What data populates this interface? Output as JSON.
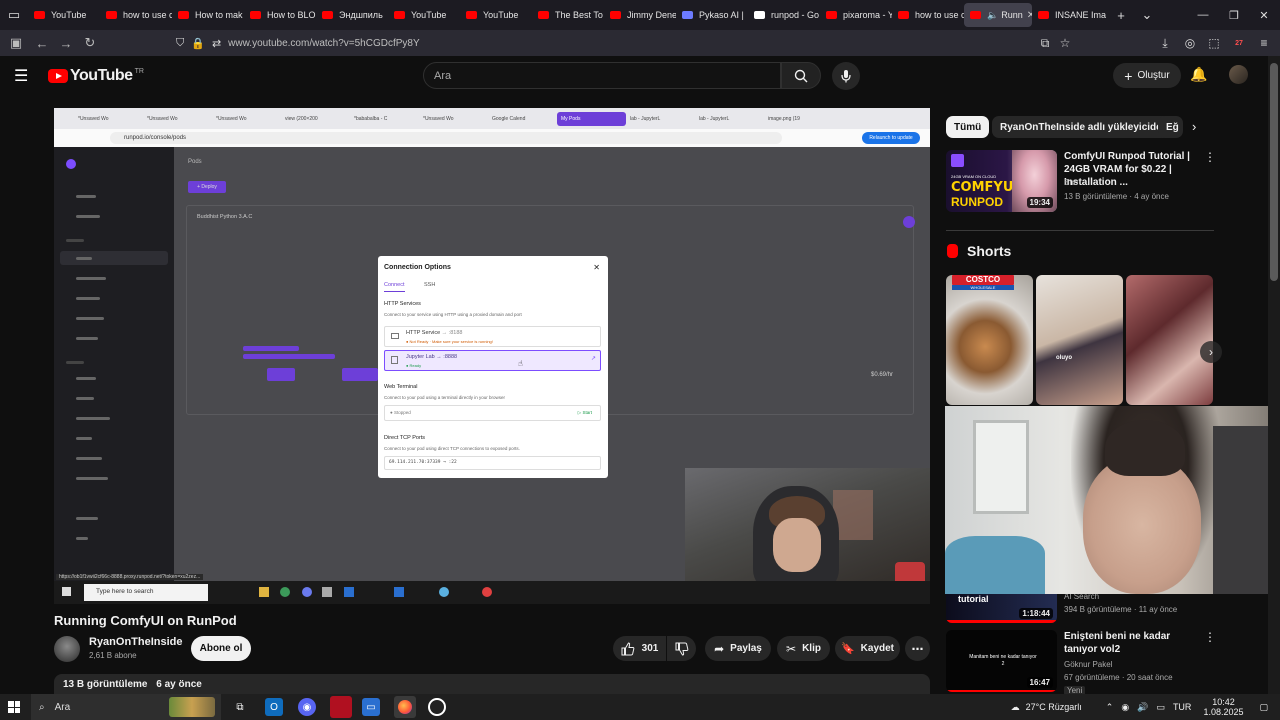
{
  "browser": {
    "tabs": [
      {
        "label": "YouTube",
        "color": "#ff0000"
      },
      {
        "label": "how to use c",
        "color": "#ff0000"
      },
      {
        "label": "How to mak",
        "color": "#ff0000"
      },
      {
        "label": "How to BLO",
        "color": "#ff0000"
      },
      {
        "label": "Эндшпиль",
        "color": "#ff0000"
      },
      {
        "label": "YouTube",
        "color": "#ff0000"
      },
      {
        "label": "YouTube",
        "color": "#ff0000"
      },
      {
        "label": "The Best To",
        "color": "#ff0000"
      },
      {
        "label": "Jimmy Dene",
        "color": "#ff0000"
      },
      {
        "label": "Pykaso AI |",
        "color": "#6c7bff"
      },
      {
        "label": "runpod - Go",
        "color": "#ffffff"
      },
      {
        "label": "pixaroma - Y",
        "color": "#ff0000"
      },
      {
        "label": "how to use c",
        "color": "#ff0000"
      }
    ],
    "active_tab": {
      "label": "Runn",
      "color": "#ff0000"
    },
    "last_tab": {
      "label": "INSANE Ima",
      "color": "#ff0000"
    },
    "url": "www.youtube.com/watch?v=5hCGDcfPy8Y",
    "notification_badge": "27"
  },
  "youtube": {
    "logo_text": "YouTube",
    "country_code": "TR",
    "search_placeholder": "Ara",
    "create_label": "Oluştur"
  },
  "video_frame": {
    "inner_tabs": [
      "*Unsaved Wo",
      "*Unsaved Wo",
      "*Unsaved Wo",
      "view (200×200",
      "*bababalba - C",
      "*Unsaved Wo",
      "Google Calend",
      "My Pods",
      "lab - JupyterL",
      "lab - JupyterL",
      "image.png (19"
    ],
    "inner_url": "runpod.io/console/pods",
    "relaunch_label": "Relaunch to update",
    "pods_title": "Pods",
    "deploy_label": "+ Deploy",
    "pod_name": "Buddhist Python 3.A.C",
    "modal": {
      "title": "Connection Options",
      "tab_connect": "Connect",
      "tab_ssh": "SSH",
      "http_title": "HTTP Services",
      "http_sub": "Connect to your service using HTTP using a proxied domain and port",
      "service1_name": "HTTP Service",
      "service1_port": "→ :8188",
      "service1_status": "● Not Ready · Make sure your service is running!",
      "service2_name": "Jupyter Lab",
      "service2_port": "→ :8888",
      "service2_status": "● Ready",
      "web_terminal_title": "Web Terminal",
      "web_terminal_sub": "Connect to your pod using a terminal directly in your browser",
      "terminal_status": "● Stopped",
      "terminal_start": "▷ Start",
      "tcp_title": "Direct TCP Ports",
      "tcp_sub": "Connect to your pod using direct TCP connections to exposed ports.",
      "tcp_value": "69.114.211.70:37339 → :22"
    },
    "status_url": "https://ob1f1vwii2cf66c-8888.proxy.runpod.net/?token=xu2zez...",
    "taskbar_search": "Type here to search",
    "price": "$0.69/hr"
  },
  "video": {
    "title": "Running ComfyUI on RunPod",
    "channel": "RyanOnTheInside",
    "subscribers": "2,61 B abone",
    "subscribe_label": "Abone ol",
    "likes": "301",
    "share_label": "Paylaş",
    "clip_label": "Klip",
    "save_label": "Kaydet",
    "views": "13 B görüntüleme",
    "age": "6 ay önce"
  },
  "sidebar": {
    "chips": [
      "Tümü",
      "RyanOnTheInside adlı yükleyiciden",
      "Eğ"
    ],
    "rec1": {
      "title": "ComfyUI Runpod Tutorial | 24GB VRAM for $0.22 | Installation ...",
      "channel": "Eno",
      "meta": "13 B görüntüleme · 4 ay önce",
      "duration": "19:34",
      "thumb_top": "24GB VRAM ON CLOUD",
      "thumb_big": "COMFYUI",
      "thumb_sub": "RUNPOD"
    },
    "shorts_label": "Shorts",
    "short1_brand": "COSTCO",
    "short1_sub": "WHOLESALE",
    "short2_caption": "oluyo",
    "rec2": {
      "channel": "AI Search",
      "meta": "394 B görüntüleme · 11 ay önce",
      "duration": "1:18:44",
      "thumb_text": "tutorial"
    },
    "rec3": {
      "title": "Enişteni beni ne kadar tanıyor vol2",
      "channel": "Göknur Pakel",
      "meta": "67 görüntüleme · 20 saat önce",
      "badge": "Yeni",
      "duration": "16:47",
      "thumb_text": "Manitam beni ne kadar tanıyor 2"
    }
  },
  "taskbar": {
    "search_label": "Ara",
    "weather": "27°C  Rüzgarlı",
    "language": "TUR",
    "time": "10:42",
    "date": "1.08.2025"
  }
}
